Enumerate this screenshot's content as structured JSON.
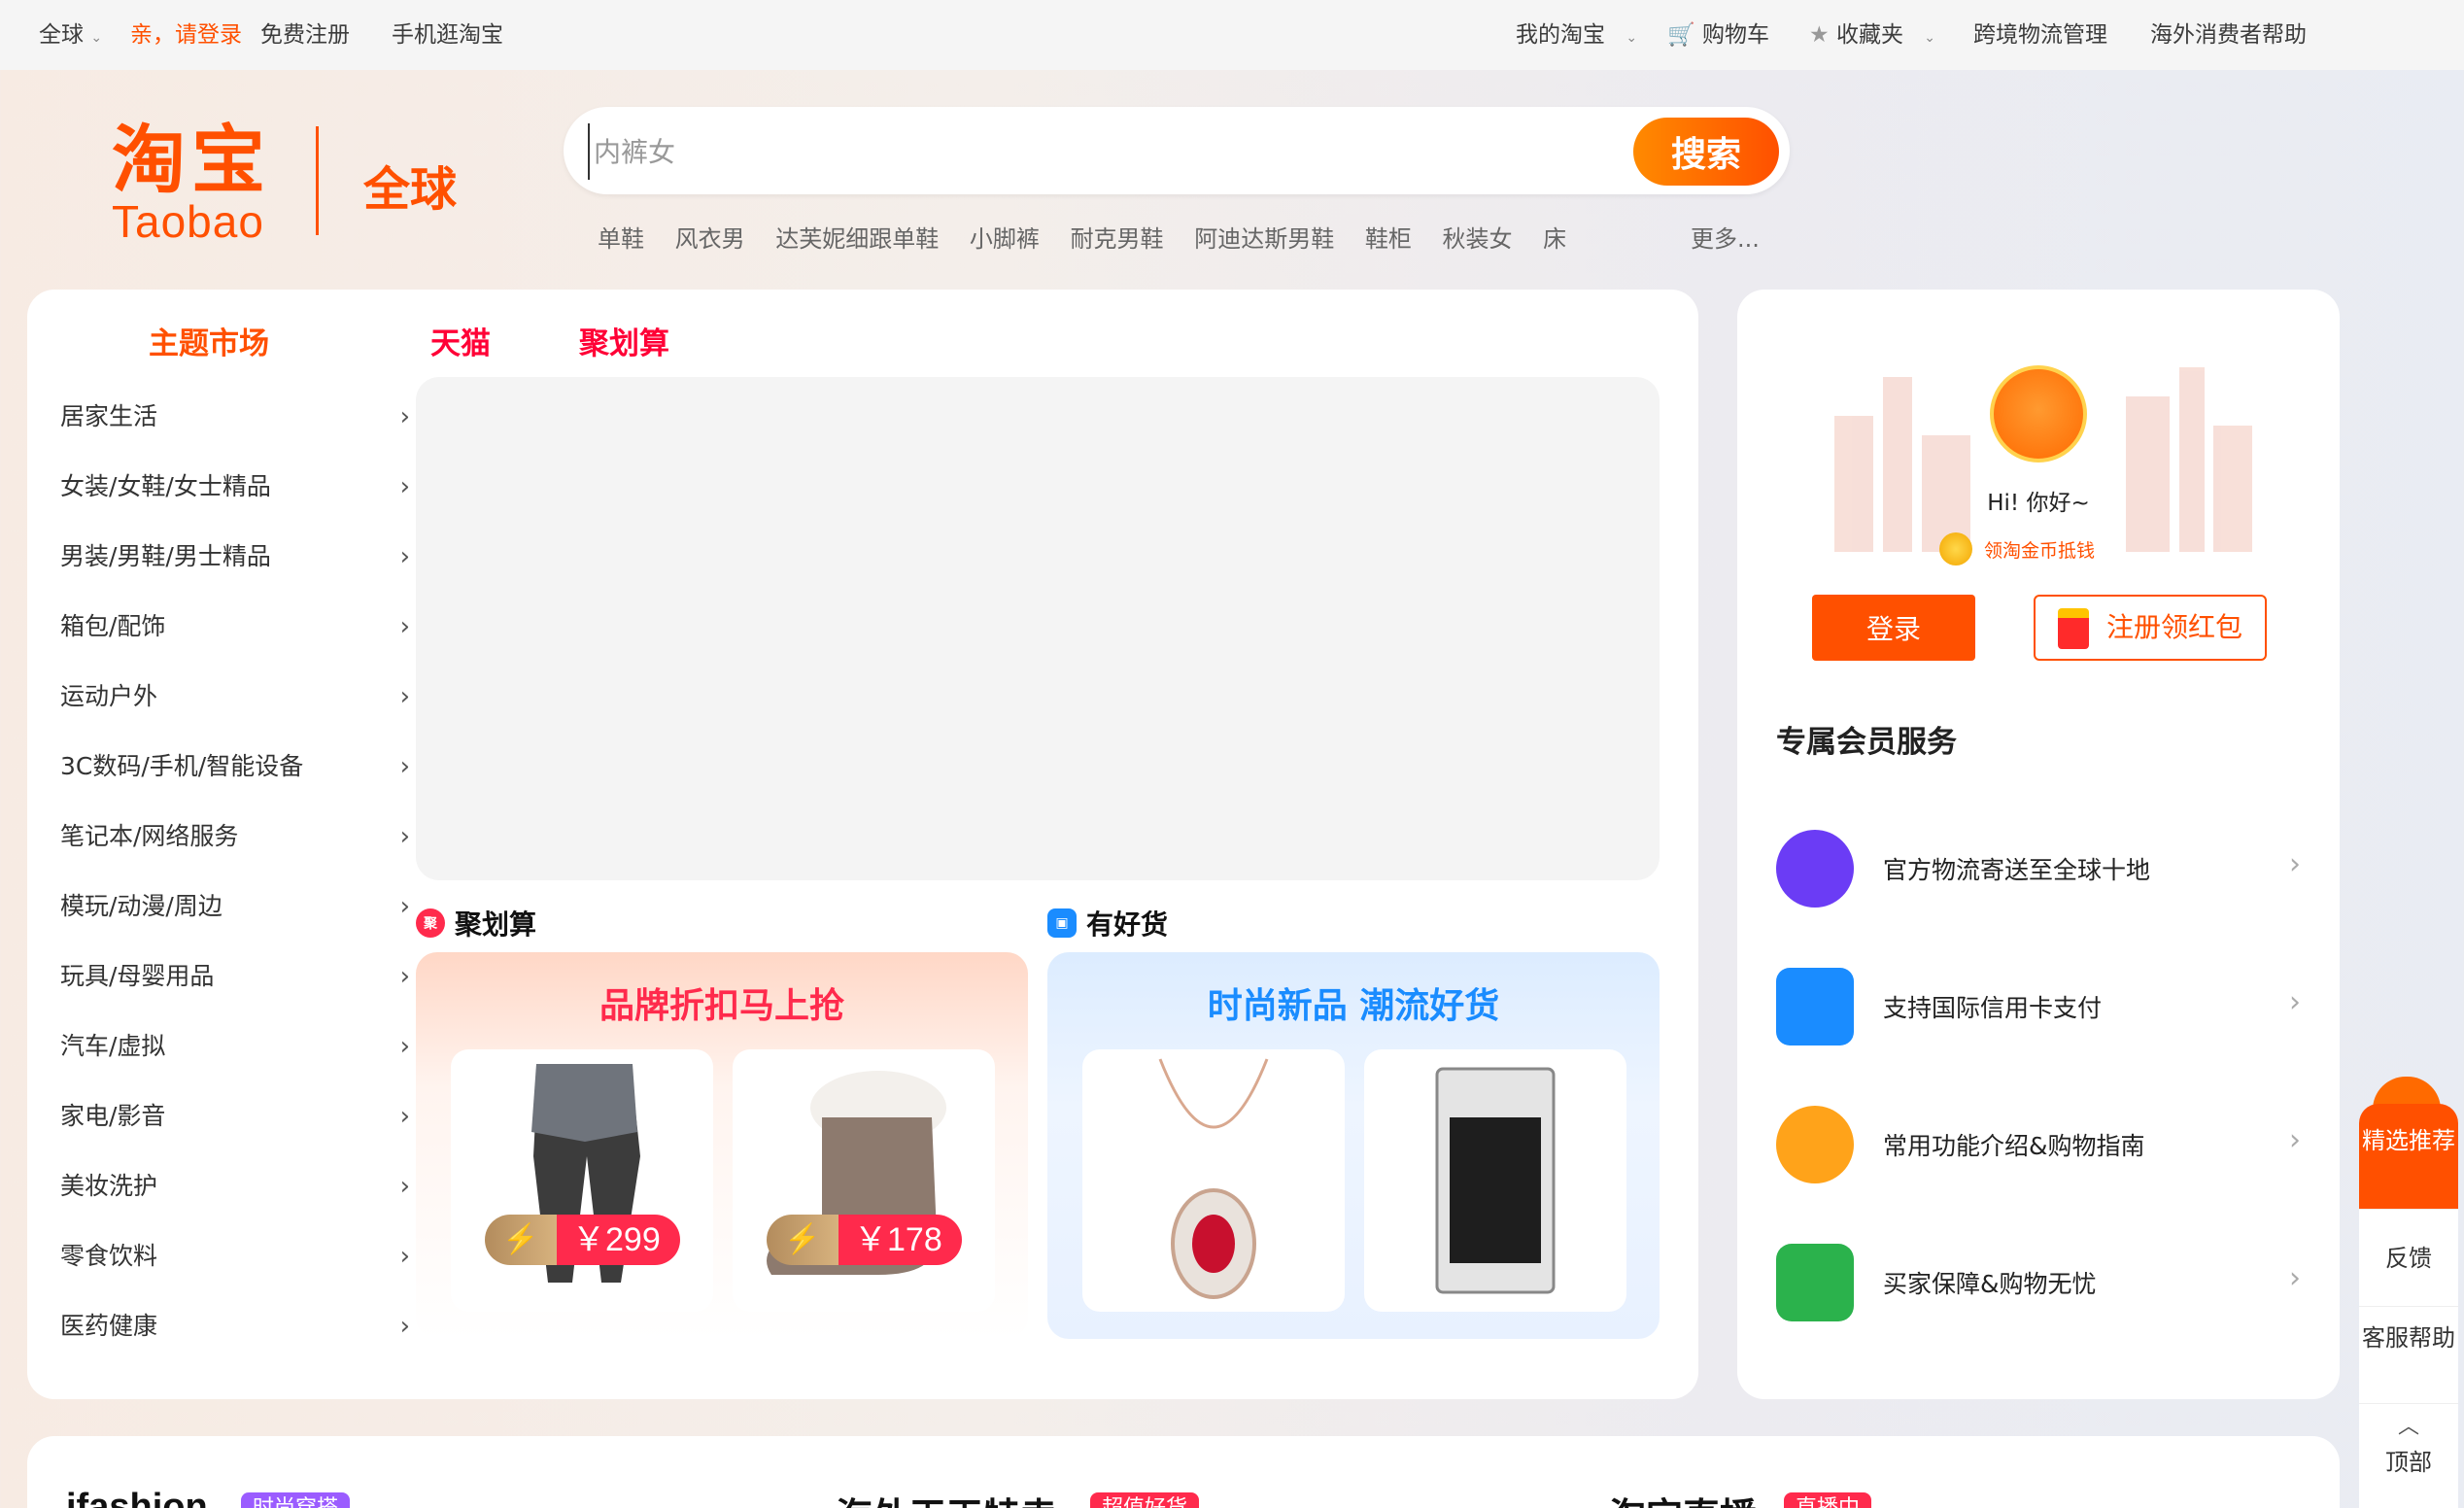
{
  "topbar": {
    "region": "全球",
    "login_prompt": "亲，请登录",
    "register": "免费注册",
    "mobile": "手机逛淘宝",
    "my_taobao": "我的淘宝",
    "cart": "购物车",
    "favorites": "收藏夹",
    "logistics": "跨境物流管理",
    "help": "海外消费者帮助"
  },
  "logo": {
    "cn": "淘宝",
    "en": "Taobao",
    "global": "全球"
  },
  "search": {
    "value": "",
    "placeholder": "内裤女",
    "button": "搜索",
    "hot_words": [
      "单鞋",
      "风衣男",
      "达芙妮细跟单鞋",
      "小脚裤",
      "耐克男鞋",
      "阿迪达斯男鞋",
      "鞋柜",
      "秋装女",
      "床"
    ],
    "more": "更多..."
  },
  "main": {
    "category_title": "主题市场",
    "tabs": [
      "天猫",
      "聚划算"
    ],
    "categories": [
      "居家生活",
      "女装/女鞋/女士精品",
      "男装/男鞋/男士精品",
      "箱包/配饰",
      "运动户外",
      "3C数码/手机/智能设备",
      "笔记本/网络服务",
      "模玩/动漫/周边",
      "玩具/母婴用品",
      "汽车/虚拟",
      "家电/影音",
      "美妆洗护",
      "零食饮料",
      "医药健康"
    ],
    "ju": {
      "label": "聚划算",
      "icon_char": "聚",
      "title": "品牌折扣马上抢",
      "prices": [
        "￥299",
        "￥178"
      ]
    },
    "yh": {
      "label": "有好货",
      "title": "时尚新品 潮流好货"
    }
  },
  "side": {
    "greeting": "Hi! 你好~",
    "coin_text": "领淘金币抵钱",
    "login": "登录",
    "register": "注册领红包",
    "member_title": "专属会员服务",
    "services": [
      {
        "text": "官方物流寄送至全球十地",
        "icon": "plane-icon",
        "color": "#6b3cf5"
      },
      {
        "text": "支持国际信用卡支付",
        "icon": "wallet-icon",
        "color": "#1a8cff"
      },
      {
        "text": "常用功能介绍&购物指南",
        "icon": "compass-icon",
        "color": "#ffa31a"
      },
      {
        "text": "买家保障&购物无忧",
        "icon": "shield-icon",
        "color": "#2bb24c"
      }
    ]
  },
  "float": {
    "featured": "精选推荐",
    "feedback": "反馈",
    "service": "客服帮助",
    "top": "顶部"
  },
  "bottom": {
    "ifashion": "ifashion",
    "ifashion_badge": "时尚穿搭",
    "overseas": "海外天天特卖",
    "overseas_badge": "超值好货",
    "live": "淘宝直播",
    "live_badge": "直播中"
  },
  "colors": {
    "brand": "#ff5000",
    "tmall": "#ff0036",
    "yh_title": "#1a8cff"
  }
}
